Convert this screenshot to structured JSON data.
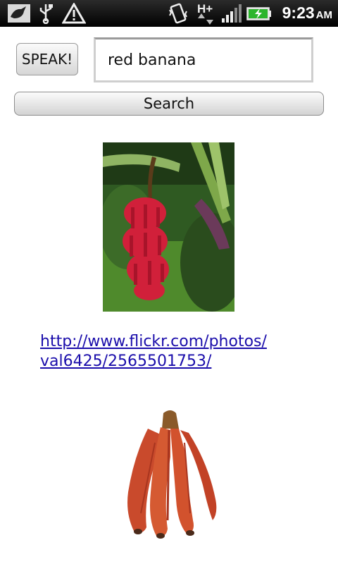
{
  "status_bar": {
    "time": "9:23",
    "ampm": "AM",
    "icons": [
      "bird-notification-icon",
      "usb-icon",
      "warning-icon",
      "vibrate-icon",
      "hplus-data-icon",
      "signal-icon",
      "battery-charging-icon"
    ],
    "network_label": "H+"
  },
  "speak_button": {
    "label": "SPEAK!"
  },
  "search_input": {
    "value": "red banana"
  },
  "search_button": {
    "label": "Search"
  },
  "results": [
    {
      "type": "image",
      "icon": "red-banana-bunch-on-tree-photo"
    },
    {
      "type": "link",
      "url_line1": "http://www.flickr.com/photos/",
      "url_line2": "val6425/2565501753/"
    },
    {
      "type": "image",
      "icon": "red-bananas-bunch-photo"
    }
  ]
}
